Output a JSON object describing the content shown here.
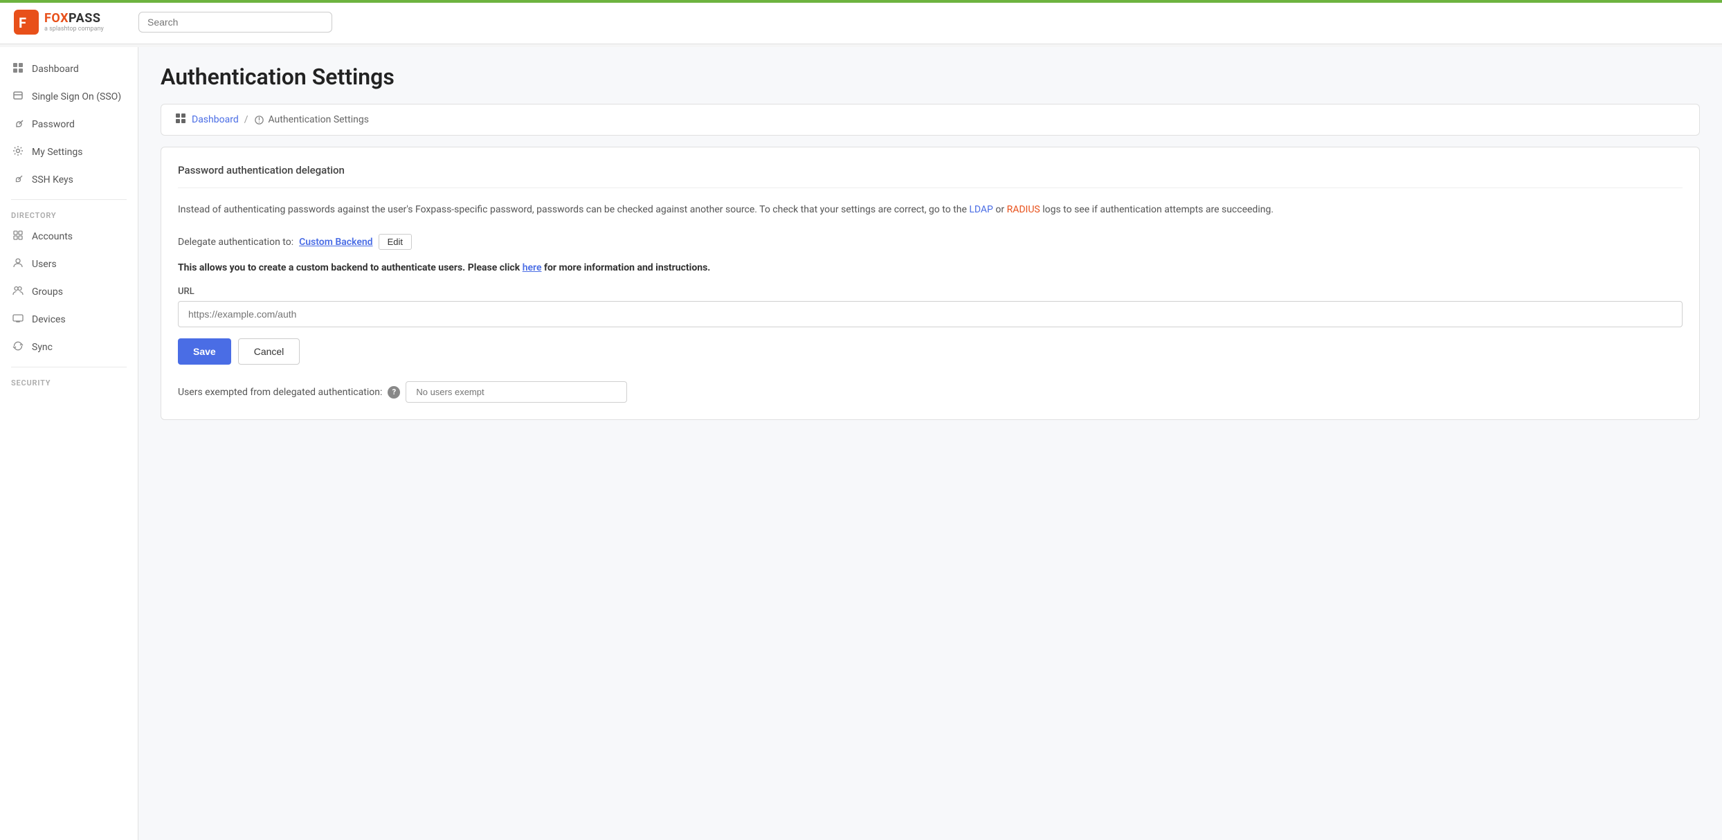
{
  "accent_color": "#6db33f",
  "header": {
    "search_placeholder": "Search"
  },
  "logo": {
    "fox": "FOX",
    "pass": "PASS",
    "subtitle": "a splashtop company"
  },
  "sidebar": {
    "items": [
      {
        "id": "dashboard",
        "label": "Dashboard",
        "icon": "🎨"
      },
      {
        "id": "sso",
        "label": "Single Sign On (SSO)",
        "icon": "🪪"
      },
      {
        "id": "password",
        "label": "Password",
        "icon": "🔑"
      },
      {
        "id": "my-settings",
        "label": "My Settings",
        "icon": "⚙️"
      },
      {
        "id": "ssh-keys",
        "label": "SSH Keys",
        "icon": "🔑"
      }
    ],
    "directory_label": "DIRECTORY",
    "directory_items": [
      {
        "id": "accounts",
        "label": "Accounts",
        "icon": "🖼️"
      },
      {
        "id": "users",
        "label": "Users",
        "icon": "👤"
      },
      {
        "id": "groups",
        "label": "Groups",
        "icon": "👥"
      },
      {
        "id": "devices",
        "label": "Devices",
        "icon": "💻"
      },
      {
        "id": "sync",
        "label": "Sync",
        "icon": "🔄"
      }
    ],
    "security_label": "SECURITY"
  },
  "page": {
    "title": "Authentication Settings",
    "breadcrumb_home": "Dashboard",
    "breadcrumb_current": "Authentication Settings"
  },
  "main": {
    "section_title": "Password authentication delegation",
    "description": "Instead of authenticating passwords against the user's Foxpass-specific password, passwords can be checked against another source. To check that your settings are correct, go to the LDAP or RADIUS logs to see if authentication attempts are succeeding.",
    "ldap_link": "LDAP",
    "radius_link": "RADIUS",
    "delegate_label": "Delegate authentication to:",
    "delegate_value": "Custom Backend",
    "edit_button": "Edit",
    "custom_backend_info": "This allows you to create a custom backend to authenticate users. Please click here for more information and instructions.",
    "here_link": "here",
    "url_label": "URL",
    "url_placeholder": "https://example.com/auth",
    "save_button": "Save",
    "cancel_button": "Cancel",
    "exempt_label": "Users exempted from delegated authentication:",
    "exempt_placeholder": "No users exempt"
  }
}
